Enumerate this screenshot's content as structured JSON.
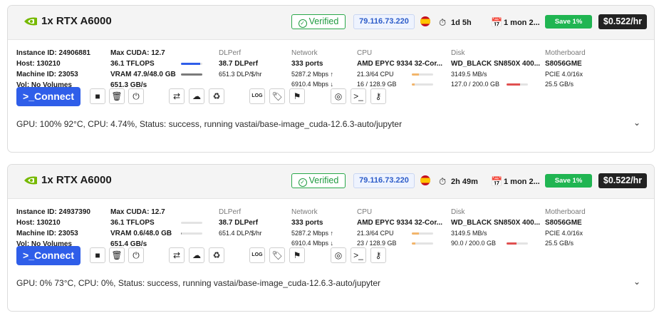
{
  "instances": [
    {
      "gpu_name": "1x RTX A6000",
      "verified": "Verified",
      "ip": "79.116.73.220",
      "duration": "1d 5h",
      "rental": "1 mon 2...",
      "save": "Save 1%",
      "price": "$0.522/hr",
      "instance_id": "Instance ID: 24906881",
      "host": "Host: 130210",
      "machine_id": "Machine ID: 23053",
      "volumes": "Vol: No Volumes",
      "max_cuda": "Max CUDA: 12.7",
      "tflops": "36.1 TFLOPS",
      "vram": "VRAM 47.9/48.0 GB",
      "bandwidth": "651.3 GB/s",
      "gpu_util": 0.9,
      "vram_util": 0.998,
      "dlperf_label": "DLPerf",
      "dlperf": "38.7 DLPerf",
      "dlperf_per_dollar": "651.3 DLP/$/hr",
      "network_label": "Network",
      "ports": "333 ports",
      "net_up": "5287.2 Mbps ↑",
      "net_down": "6910.4 Mbps ↓",
      "cpu_label": "CPU",
      "cpu_name": "AMD EPYC 9334 32-Cor...",
      "cpu_cores": "21.3/64 CPU",
      "ram": "16 / 128.9 GB",
      "cpu_util": 0.333,
      "ram_util": 0.124,
      "disk_label": "Disk",
      "disk_name": "WD_BLACK SN850X 400...",
      "disk_speed": "3149.5 MB/s",
      "disk_usage": "127.0 / 200.0 GB",
      "disk_util": 0.635,
      "mobo_label": "Motherboard",
      "mobo": "S8056GME",
      "pcie": "PCIE 4.0/16x",
      "pcie_bw": "25.5 GB/s",
      "connect": ">_Connect",
      "status": "GPU: 100% 92°C, CPU: 4.74%, Status: success, running vastai/base-image_cuda-12.6.3-auto/jupyter"
    },
    {
      "gpu_name": "1x RTX A6000",
      "verified": "Verified",
      "ip": "79.116.73.220",
      "duration": "2h 49m",
      "rental": "1 mon 2...",
      "save": "Save 1%",
      "price": "$0.522/hr",
      "instance_id": "Instance ID: 24937390",
      "host": "Host: 130210",
      "machine_id": "Machine ID: 23053",
      "volumes": "Vol: No Volumes",
      "max_cuda": "Max CUDA: 12.7",
      "tflops": "36.1 TFLOPS",
      "vram": "VRAM 0.6/48.0 GB",
      "bandwidth": "651.4 GB/s",
      "gpu_util": 0.0,
      "vram_util": 0.0125,
      "dlperf_label": "DLPerf",
      "dlperf": "38.7 DLPerf",
      "dlperf_per_dollar": "651.4 DLP/$/hr",
      "network_label": "Network",
      "ports": "333 ports",
      "net_up": "5287.2 Mbps ↑",
      "net_down": "6910.4 Mbps ↓",
      "cpu_label": "CPU",
      "cpu_name": "AMD EPYC 9334 32-Cor...",
      "cpu_cores": "21.3/64 CPU",
      "ram": "23 / 128.9 GB",
      "cpu_util": 0.333,
      "ram_util": 0.178,
      "disk_label": "Disk",
      "disk_name": "WD_BLACK SN850X 400...",
      "disk_speed": "3149.5 MB/s",
      "disk_usage": "90.0 / 200.0 GB",
      "disk_util": 0.45,
      "mobo_label": "Motherboard",
      "mobo": "S8056GME",
      "pcie": "PCIE 4.0/16x",
      "pcie_bw": "25.5 GB/s",
      "connect": ">_Connect",
      "status": "GPU: 0% 73°C, CPU: 0%, Status: success, running vastai/base-image_cuda-12.6.3-auto/jupyter"
    }
  ],
  "colors": {
    "accent": "#2f5ee9",
    "verified": "#1f9a3f",
    "save": "#20b552",
    "gpu_bar": "#2f5ee9",
    "vram_bar": "#7a7a7a",
    "cpu_bar": "#f2b56b",
    "disk_bar": "#e05050"
  },
  "icons": [
    "nvidia-logo-icon",
    "check-circle-icon",
    "spain-flag-icon",
    "stopwatch-icon",
    "calendar-icon",
    "stop-icon",
    "trash-icon",
    "power-icon",
    "transfer-icon",
    "cloud-icon",
    "recycle-icon",
    "log-icon",
    "tag-icon",
    "flag-icon",
    "jupyter-icon",
    "terminal-icon",
    "key-icon",
    "chevron-down-icon"
  ]
}
